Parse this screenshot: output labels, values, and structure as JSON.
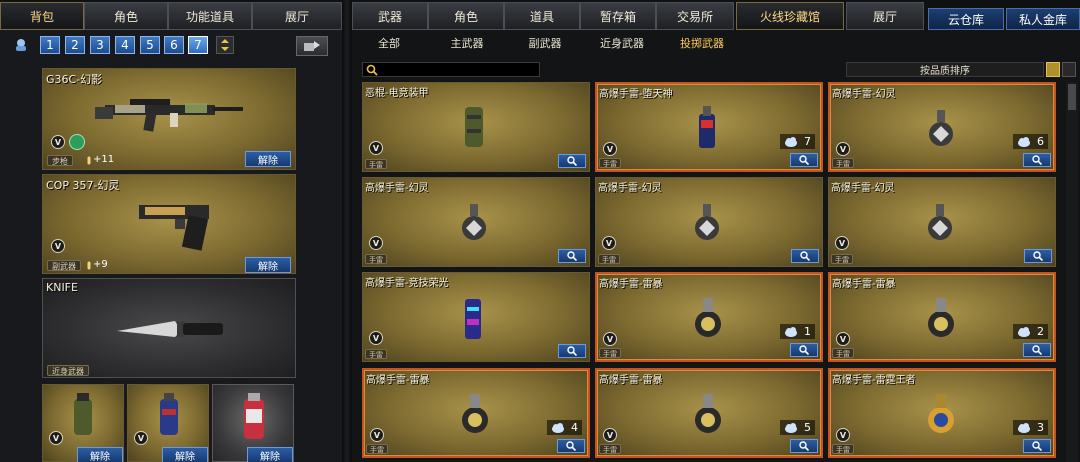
{
  "left_tabs": [
    "背包",
    "角色",
    "功能道具",
    "展厅"
  ],
  "right_tabs": [
    "武器",
    "角色",
    "道具",
    "暂存箱",
    "交易所",
    "火线珍藏馆",
    "展厅"
  ],
  "storage_tabs": [
    "云仓库",
    "私人金库"
  ],
  "sub_tabs": [
    "全部",
    "主武器",
    "副武器",
    "近身武器",
    "投掷武器"
  ],
  "pages": [
    "1",
    "2",
    "3",
    "4",
    "5",
    "6",
    "7"
  ],
  "equipped": {
    "unbind_label": "解除",
    "primary": {
      "name": "G36C-幻影",
      "category": "步枪",
      "ammo": "+11"
    },
    "secondary": {
      "name": "COP 357-幻灵",
      "category": "副武器",
      "ammo": "+9"
    },
    "melee": {
      "name": "KNIFE",
      "category": "近身武器"
    }
  },
  "sort_label": "按品质排序",
  "mini_badge": "手雷",
  "items": [
    {
      "name": "恶棍-电竞装甲",
      "count": "",
      "selected": false,
      "type": "smoke"
    },
    {
      "name": "高爆手雷-堕天神",
      "count": "7",
      "selected": true,
      "type": "redcan"
    },
    {
      "name": "高爆手雷-幻灵",
      "count": "6",
      "selected": true,
      "type": "grenade"
    },
    {
      "name": "高爆手雷-幻灵",
      "count": "",
      "selected": false,
      "type": "grenade"
    },
    {
      "name": "高爆手雷-幻灵",
      "count": "",
      "selected": false,
      "type": "grenade"
    },
    {
      "name": "高爆手雷-幻灵",
      "count": "",
      "selected": false,
      "type": "grenade"
    },
    {
      "name": "高爆手雷-竞技荣光",
      "count": "",
      "selected": false,
      "type": "bluecan"
    },
    {
      "name": "高爆手雷-雷暴",
      "count": "1",
      "selected": true,
      "type": "thunder"
    },
    {
      "name": "高爆手雷-雷暴",
      "count": "2",
      "selected": true,
      "type": "thunder"
    },
    {
      "name": "高爆手雷-雷暴",
      "count": "4",
      "selected": true,
      "type": "thunder"
    },
    {
      "name": "高爆手雷-雷暴",
      "count": "5",
      "selected": true,
      "type": "thunder"
    },
    {
      "name": "高爆手雷-雷霆王者",
      "count": "3",
      "selected": true,
      "type": "king"
    }
  ],
  "colors": {
    "accent": "#ffcc55",
    "selected_border": "#c4541e",
    "button_blue": "#2b5da6"
  }
}
